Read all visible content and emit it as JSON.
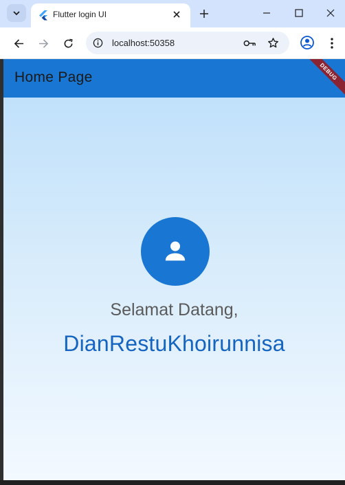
{
  "browser": {
    "tab": {
      "title": "Flutter login UI"
    },
    "address": {
      "url": "localhost:50358"
    }
  },
  "app": {
    "appbar_title": "Home Page",
    "debug_banner": "DEBUG",
    "welcome_text": "Selamat Datang,",
    "user_name": "DianRestuKhoirunnisa"
  },
  "colors": {
    "primary": "#1976d2",
    "username": "#1565c0",
    "debug_banner": "#8a2432"
  },
  "icons": [
    "tab-search-icon",
    "flutter-icon",
    "close-icon",
    "plus-icon",
    "minimize-icon",
    "maximize-icon",
    "back-icon",
    "forward-icon",
    "reload-icon",
    "info-icon",
    "key-icon",
    "star-icon",
    "profile-icon",
    "more-vert-icon",
    "person-icon"
  ]
}
